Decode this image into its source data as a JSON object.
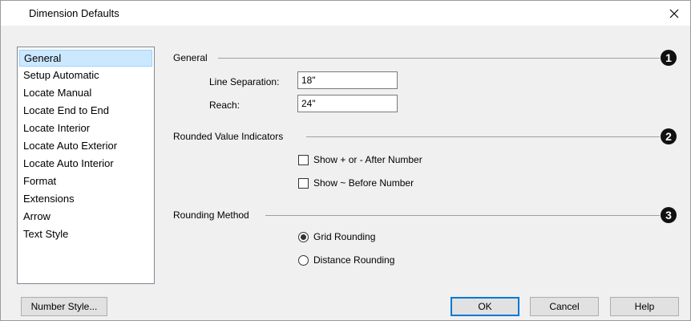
{
  "window": {
    "title": "Dimension Defaults"
  },
  "nav": {
    "items": [
      {
        "label": "General",
        "selected": true
      },
      {
        "label": "Setup Automatic"
      },
      {
        "label": "Locate Manual"
      },
      {
        "label": "Locate End to End"
      },
      {
        "label": "Locate Interior"
      },
      {
        "label": "Locate Auto Exterior"
      },
      {
        "label": "Locate Auto Interior"
      },
      {
        "label": "Format"
      },
      {
        "label": "Extensions"
      },
      {
        "label": "Arrow"
      },
      {
        "label": "Text Style"
      }
    ]
  },
  "general": {
    "group_label": "General",
    "callout": "1",
    "line_separation_label": "Line Separation:",
    "line_separation_value": "18\"",
    "reach_label": "Reach:",
    "reach_value": "24\""
  },
  "rounded": {
    "group_label": "Rounded Value Indicators",
    "callout": "2",
    "show_plus_minus_label": "Show + or - After Number",
    "show_plus_minus_checked": false,
    "show_tilde_label": "Show ~ Before Number",
    "show_tilde_checked": false
  },
  "rounding": {
    "group_label": "Rounding Method",
    "callout": "3",
    "grid_label": "Grid Rounding",
    "grid_selected": true,
    "distance_label": "Distance Rounding",
    "distance_selected": false
  },
  "buttons": {
    "number_style": "Number Style...",
    "ok": "OK",
    "cancel": "Cancel",
    "help": "Help"
  },
  "colors": {
    "selection_bg": "#cce8ff",
    "default_button_border": "#0078d7",
    "callout_bg": "#111111"
  }
}
